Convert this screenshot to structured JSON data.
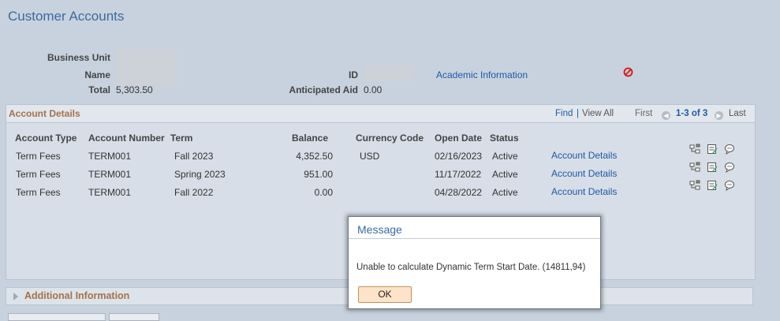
{
  "page": {
    "title": "Customer Accounts"
  },
  "summary": {
    "business_unit_label": "Business Unit",
    "name_label": "Name",
    "total_label": "Total",
    "total_value": "5,303.50",
    "id_label": "ID",
    "anticipated_aid_label": "Anticipated Aid",
    "anticipated_aid_value": "0.00",
    "academic_info_link": "Academic Information"
  },
  "grid": {
    "title": "Account Details",
    "find_label": "Find",
    "separator": "|",
    "view_all_label": "View All",
    "first_label": "First",
    "range_label": "1-3 of 3",
    "last_label": "Last",
    "columns": [
      "Account Type",
      "Account Number",
      "Term",
      "Balance",
      "Currency Code",
      "Open Date",
      "Status"
    ],
    "rows": [
      {
        "account_type": "Term Fees",
        "account_number": "TERM001",
        "term": "Fall 2023",
        "balance": "4,352.50",
        "currency": "USD",
        "open_date": "02/16/2023",
        "status": "Active",
        "link": "Account Details"
      },
      {
        "account_type": "Term Fees",
        "account_number": "TERM001",
        "term": "Spring 2023",
        "balance": "951.00",
        "currency": "",
        "open_date": "11/17/2022",
        "status": "Active",
        "link": "Account Details"
      },
      {
        "account_type": "Term Fees",
        "account_number": "TERM001",
        "term": "Fall 2022",
        "balance": "0.00",
        "currency": "",
        "open_date": "04/28/2022",
        "status": "Active",
        "link": "Account Details"
      }
    ]
  },
  "additional": {
    "label": "Additional Information"
  },
  "dialog": {
    "title": "Message",
    "message": "Unable to calculate Dynamic Term Start Date. (14811,94)",
    "ok_label": "OK"
  },
  "icons": {
    "prohibited": "prohibited-icon",
    "row_icons": [
      "view-tree-icon",
      "edit-note-icon",
      "comment-icon"
    ],
    "prev": "previous-arrow-icon",
    "next": "next-arrow-icon",
    "expand": "expand-triangle-icon"
  },
  "colors": {
    "accent": "#3b6aa0",
    "section_title": "#a6704a",
    "link": "#1f58a8",
    "ok_button": "#fde3c8"
  }
}
